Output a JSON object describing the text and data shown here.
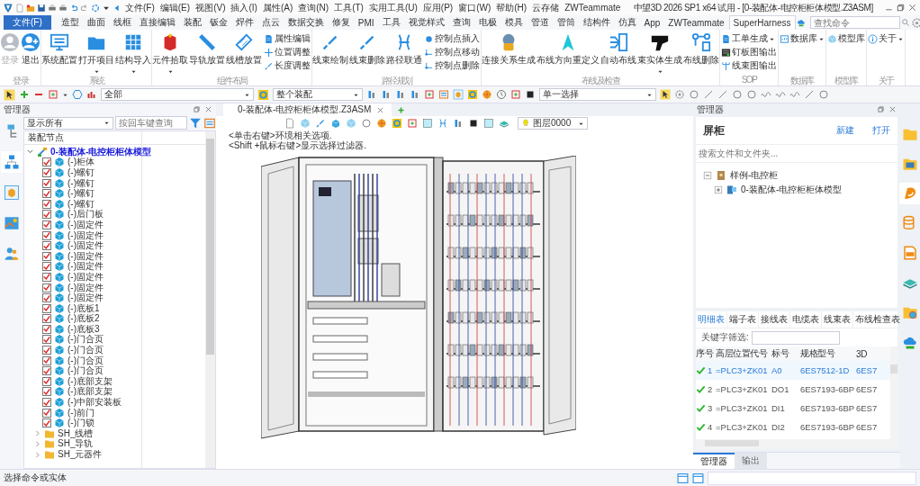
{
  "window": {
    "title": "中望3D 2026 SP1 x64 试用 - [0-装配体-电控柜柜体模型.Z3ASM]",
    "menus": [
      "文件(F)",
      "编辑(E)",
      "视图(V)",
      "插入(I)",
      "属性(A)",
      "查询(N)",
      "工具(T)",
      "实用工具(U)",
      "应用(P)",
      "窗口(W)",
      "帮助(H)",
      "云存储",
      "ZWTeammate"
    ]
  },
  "ribbon_tabs": [
    {
      "label": "文件(F)",
      "kind": "file",
      "selected": false
    },
    {
      "label": "造型",
      "kind": "tab",
      "selected": false
    },
    {
      "label": "曲面",
      "kind": "tab",
      "selected": false
    },
    {
      "label": "线框",
      "kind": "tab",
      "selected": false
    },
    {
      "label": "直接编辑",
      "kind": "tab",
      "selected": false
    },
    {
      "label": "装配",
      "kind": "tab",
      "selected": false
    },
    {
      "label": "钣金",
      "kind": "tab",
      "selected": false
    },
    {
      "label": "焊件",
      "kind": "tab",
      "selected": false
    },
    {
      "label": "点云",
      "kind": "tab",
      "selected": false
    },
    {
      "label": "数据交换",
      "kind": "tab",
      "selected": false
    },
    {
      "label": "修复",
      "kind": "tab",
      "selected": false
    },
    {
      "label": "PMI",
      "kind": "tab",
      "selected": false
    },
    {
      "label": "工具",
      "kind": "tab",
      "selected": false
    },
    {
      "label": "视觉样式",
      "kind": "tab",
      "selected": false
    },
    {
      "label": "查询",
      "kind": "tab",
      "selected": false
    },
    {
      "label": "电极",
      "kind": "tab",
      "selected": false
    },
    {
      "label": "模具",
      "kind": "tab",
      "selected": false
    },
    {
      "label": "管道",
      "kind": "tab",
      "selected": false
    },
    {
      "label": "管筒",
      "kind": "tab",
      "selected": false
    },
    {
      "label": "结构件",
      "kind": "tab",
      "selected": false
    },
    {
      "label": "仿真",
      "kind": "tab",
      "selected": false
    },
    {
      "label": "App",
      "kind": "tab",
      "selected": false
    },
    {
      "label": "ZWTeammate",
      "kind": "tab",
      "selected": false
    },
    {
      "label": "SuperHarness",
      "kind": "tab",
      "selected": true
    }
  ],
  "command_search": {
    "placeholder": "查找命令"
  },
  "ribbon_groups": [
    {
      "label": "登录",
      "buttons": [
        {
          "label": "登录",
          "kind": "large",
          "dropdown": false,
          "disabled": true
        },
        {
          "label": "退出",
          "kind": "large",
          "dropdown": false,
          "disabled": false
        }
      ]
    },
    {
      "label": "系统",
      "buttons": [
        {
          "label": "系统配置",
          "kind": "large",
          "dropdown": false,
          "disabled": false
        },
        {
          "label": "打开项目",
          "kind": "large",
          "dropdown": true,
          "disabled": false
        },
        {
          "label": "结构导入",
          "kind": "large",
          "dropdown": true,
          "disabled": false
        }
      ]
    },
    {
      "label": "组件布局",
      "buttons": [
        {
          "label": "元件拾取",
          "kind": "large",
          "dropdown": true,
          "disabled": false
        },
        {
          "label": "导轨放置",
          "kind": "large",
          "dropdown": false,
          "disabled": false
        },
        {
          "label": "线槽放置",
          "kind": "large",
          "dropdown": false,
          "disabled": false
        },
        {
          "label": "属性编辑",
          "kind": "small",
          "dropdown": false,
          "disabled": false
        },
        {
          "label": "位置调整",
          "kind": "small",
          "dropdown": false,
          "disabled": false
        },
        {
          "label": "长度调整",
          "kind": "small",
          "dropdown": false,
          "disabled": false
        }
      ]
    },
    {
      "label": "路径规划",
      "buttons": [
        {
          "label": "线束绘制",
          "kind": "large",
          "dropdown": false,
          "disabled": false
        },
        {
          "label": "线束删除",
          "kind": "large",
          "dropdown": false,
          "disabled": false
        },
        {
          "label": "路径联通",
          "kind": "large",
          "dropdown": false,
          "disabled": false
        },
        {
          "label": "控制点插入",
          "kind": "small",
          "dropdown": false,
          "disabled": false
        },
        {
          "label": "控制点移动",
          "kind": "small",
          "dropdown": false,
          "disabled": false
        },
        {
          "label": "控制点删除",
          "kind": "small",
          "dropdown": false,
          "disabled": false
        }
      ]
    },
    {
      "label": "布线及检查",
      "buttons": [
        {
          "label": "连接关系生成",
          "kind": "large",
          "dropdown": false,
          "disabled": false
        },
        {
          "label": "布线方向重定义",
          "kind": "large",
          "dropdown": false,
          "disabled": false
        },
        {
          "label": "自动布线",
          "kind": "large",
          "dropdown": false,
          "disabled": false
        },
        {
          "label": "束实体生成",
          "kind": "large",
          "dropdown": true,
          "disabled": false
        },
        {
          "label": "布线删除",
          "kind": "large",
          "dropdown": false,
          "disabled": false
        }
      ]
    },
    {
      "label": "SOP",
      "buttons": [
        {
          "label": "工单生成",
          "kind": "small",
          "dropdown": true,
          "disabled": false
        },
        {
          "label": "钉板图输出",
          "kind": "small",
          "dropdown": false,
          "disabled": false
        },
        {
          "label": "线束图输出",
          "kind": "small",
          "dropdown": false,
          "disabled": false
        }
      ]
    },
    {
      "label": "数据库",
      "buttons": [
        {
          "label": "数据库",
          "kind": "small",
          "dropdown": true,
          "disabled": false
        }
      ]
    },
    {
      "label": "模型库",
      "buttons": [
        {
          "label": "模型库",
          "kind": "small",
          "dropdown": false,
          "disabled": false
        }
      ]
    },
    {
      "label": "关于",
      "buttons": [
        {
          "label": "关于",
          "kind": "small",
          "dropdown": true,
          "disabled": false
        }
      ]
    }
  ],
  "toolbar": {
    "filter_combo": "全部",
    "scope_combo": "整个装配",
    "select_combo": "单一选择"
  },
  "left_panel": {
    "title": "管理器",
    "display_combo": "显示所有",
    "search_placeholder": "按回车键查询",
    "column": "装配节点",
    "root": {
      "label": "0-装配体-电控柜柜体模型",
      "expanded": true,
      "children": [
        {
          "label": "(-)柜体",
          "checked": true
        },
        {
          "label": "(-)螺钉",
          "checked": true
        },
        {
          "label": "(-)螺钉",
          "checked": true
        },
        {
          "label": "(-)螺钉",
          "checked": true
        },
        {
          "label": "(-)螺钉",
          "checked": true
        },
        {
          "label": "(-)后门板",
          "checked": true
        },
        {
          "label": "(-)固定件",
          "checked": true
        },
        {
          "label": "(-)固定件",
          "checked": true
        },
        {
          "label": "(-)固定件",
          "checked": true
        },
        {
          "label": "(-)固定件",
          "checked": true
        },
        {
          "label": "(-)固定件",
          "checked": true
        },
        {
          "label": "(-)固定件",
          "checked": true
        },
        {
          "label": "(-)固定件",
          "checked": true
        },
        {
          "label": "(-)固定件",
          "checked": true
        },
        {
          "label": "(-)底板1",
          "checked": true
        },
        {
          "label": "(-)底板2",
          "checked": true
        },
        {
          "label": "(-)底板3",
          "checked": true
        },
        {
          "label": "(-)门合页",
          "checked": true
        },
        {
          "label": "(-)门合页",
          "checked": true
        },
        {
          "label": "(-)门合页",
          "checked": true
        },
        {
          "label": "(-)门合页",
          "checked": true
        },
        {
          "label": "(-)底部支架",
          "checked": true
        },
        {
          "label": "(-)底部支架",
          "checked": true
        },
        {
          "label": "(-)中部安装板",
          "checked": true
        },
        {
          "label": "(-)前门",
          "checked": true
        },
        {
          "label": "(-)门锁",
          "checked": true
        }
      ]
    },
    "folders": [
      {
        "label": "SH_线槽",
        "expanded": false
      },
      {
        "label": "SH_导轨",
        "expanded": false
      },
      {
        "label": "SH_元器件",
        "expanded": false
      }
    ]
  },
  "document": {
    "tab": "0-装配体-电控柜柜体模型.Z3ASM",
    "layer_combo": "图层0000",
    "hints": [
      "<单击右键>环境相关选项.",
      "<Shift +鼠标右键>显示选择过滤器."
    ]
  },
  "right_panel": {
    "title": "管理器",
    "header": "屏柜",
    "actions": [
      "新建",
      "打开"
    ],
    "search_placeholder": "搜索文件和文件夹...",
    "tree": [
      {
        "label": "样例-电控柜",
        "expanded": true,
        "children": [
          {
            "label": "0-装配体-电控柜柜体模型",
            "expanded": false
          }
        ]
      }
    ],
    "table_tabs": [
      {
        "label": "明细表",
        "selected": true
      },
      {
        "label": "端子表",
        "selected": false
      },
      {
        "label": "接线表",
        "selected": false
      },
      {
        "label": "电缆表",
        "selected": false
      },
      {
        "label": "线束表",
        "selected": false
      },
      {
        "label": "布线检查表",
        "selected": false
      }
    ],
    "filter_label": "关键字筛选:",
    "columns": [
      "序号",
      "高层位置代号",
      "标号",
      "规格型号",
      "3D"
    ],
    "rows": [
      {
        "passed": true,
        "selected": true,
        "cells": [
          "1",
          "=PLC3+ZK01",
          "A0",
          "6ES7512-1D",
          "6ES7"
        ]
      },
      {
        "passed": true,
        "selected": false,
        "cells": [
          "2",
          "=PLC3+ZK01",
          "DO1",
          "6ES7193-6BP",
          "6ES7"
        ]
      },
      {
        "passed": true,
        "selected": false,
        "cells": [
          "3",
          "=PLC3+ZK01",
          "DI1",
          "6ES7193-6BP",
          "6ES7"
        ]
      },
      {
        "passed": true,
        "selected": false,
        "cells": [
          "4",
          "=PLC3+ZK01",
          "DI2",
          "6ES7193-6BP",
          "6ES7"
        ]
      }
    ],
    "bottom_tabs": [
      {
        "label": "管理器",
        "selected": true
      },
      {
        "label": "输出",
        "selected": false
      }
    ]
  },
  "status_bar": {
    "text": "选择命令或实体"
  }
}
